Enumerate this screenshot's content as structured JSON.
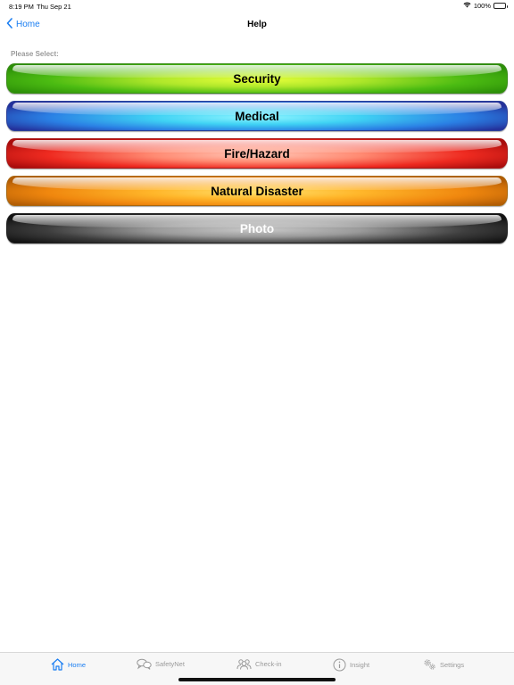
{
  "status_bar": {
    "time": "8:19 PM",
    "date": "Thu Sep 21",
    "battery": "100%",
    "icons": [
      "wifi-icon",
      "battery-icon"
    ]
  },
  "nav": {
    "back_label": "Home",
    "title": "Help"
  },
  "prompt": "Please Select:",
  "options": [
    {
      "label": "Security",
      "color": "#4bbb12"
    },
    {
      "label": "Medical",
      "color": "#2a7fe4"
    },
    {
      "label": "Fire/Hazard",
      "color": "#ee2a20"
    },
    {
      "label": "Natural Disaster",
      "color": "#f0870e"
    },
    {
      "label": "Photo",
      "color": "#3e3e3e"
    }
  ],
  "tabs": [
    {
      "label": "Home",
      "icon": "home-icon",
      "active": true
    },
    {
      "label": "SafetyNet",
      "icon": "chat-bubbles-icon",
      "active": false
    },
    {
      "label": "Check-in",
      "icon": "group-icon",
      "active": false
    },
    {
      "label": "Insight",
      "icon": "info-icon",
      "active": false
    },
    {
      "label": "Settings",
      "icon": "gears-icon",
      "active": false
    }
  ],
  "colors": {
    "accent": "#1a7ef2",
    "inactive_tab": "#999999"
  }
}
